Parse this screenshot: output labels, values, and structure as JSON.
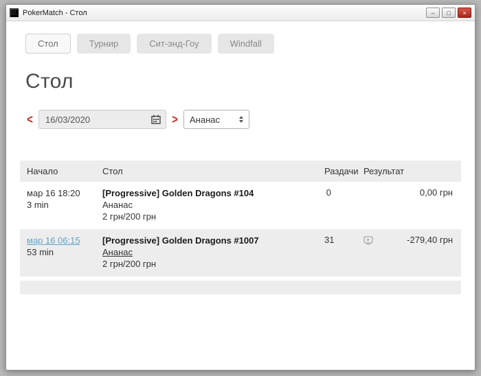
{
  "window": {
    "title": "PokerMatch - Стол",
    "minimize_glyph": "–",
    "maximize_glyph": "□",
    "close_glyph": "×"
  },
  "tabs": [
    {
      "label": "Стол",
      "active": true
    },
    {
      "label": "Турнир",
      "active": false
    },
    {
      "label": "Сит-энд-Гоу",
      "active": false
    },
    {
      "label": "Windfall",
      "active": false
    }
  ],
  "page": {
    "title": "Стол"
  },
  "filters": {
    "prev_glyph": "<",
    "next_glyph": ">",
    "date_value": "16/03/2020",
    "game_selected": "Ананас"
  },
  "table": {
    "headers": {
      "start": "Начало",
      "table": "Стол",
      "hands": "Раздачи",
      "result": "Результат"
    },
    "rows": [
      {
        "start": "мар 16 18:20",
        "duration": "3 min",
        "name": "[Progressive] Golden Dragons #104",
        "game": "Ананас",
        "stakes": "2 грн/200 грн",
        "hands": "0",
        "result": "0,00 грн"
      },
      {
        "start": "мар 16 06:15",
        "duration": "53 min",
        "name": "[Progressive] Golden Dragons #1007",
        "game": "Ананас",
        "stakes": "2 грн/200 грн",
        "hands": "31",
        "result": "-279,40 грн"
      }
    ]
  },
  "colors": {
    "accent_red": "#c03028",
    "link_blue": "#5fa3c8",
    "row_alt_bg": "#ededed"
  }
}
